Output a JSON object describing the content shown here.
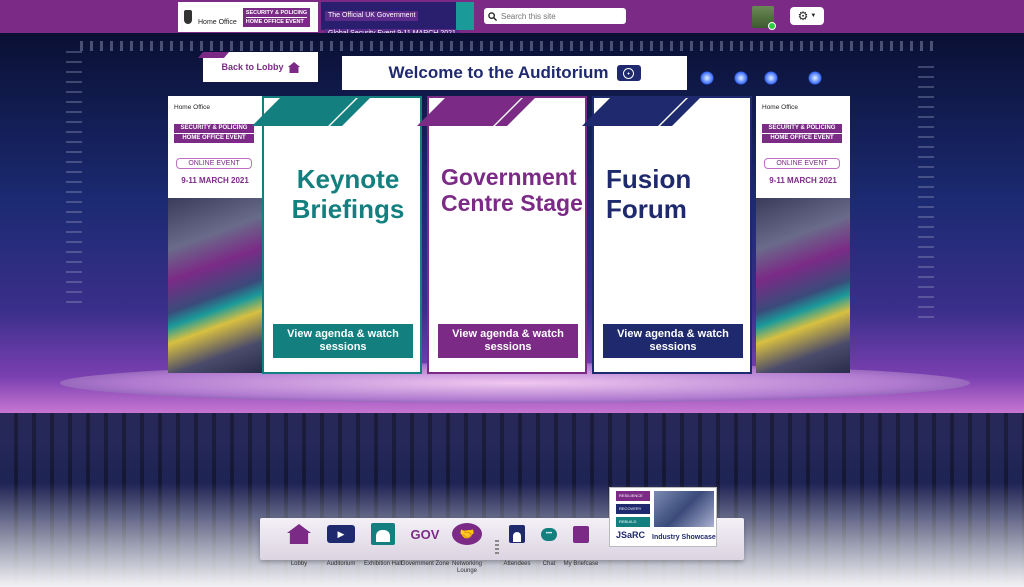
{
  "header": {
    "home_office": "Home Office",
    "security_policing": "SECURITY & POLICING",
    "home_office_event": "HOME OFFICE EVENT",
    "official_line1": "The Official UK Government",
    "official_line2": "Global Security Event  9-11 MARCH 2021",
    "search_placeholder": "Search this site",
    "settings_icon": "gear-icon"
  },
  "page": {
    "back_label": "Back to Lobby",
    "welcome_title": "Welcome to the Auditorium"
  },
  "banner": {
    "home_office": "Home Office",
    "security_policing": "SECURITY & POLICING",
    "home_office_event": "HOME OFFICE EVENT",
    "online_event": "ONLINE EVENT",
    "date": "9-11 MARCH 2021"
  },
  "panels": [
    {
      "title": "Keynote Briefings",
      "cta": "View agenda & watch sessions",
      "color": "#137f7f"
    },
    {
      "title": "Government Centre Stage",
      "cta": "View agenda & watch sessions",
      "color": "#7b2b86"
    },
    {
      "title": "Fusion Forum",
      "cta": "View agenda & watch sessions",
      "color": "#1f2a6e"
    }
  ],
  "nav": {
    "items": [
      {
        "label": "Lobby",
        "icon": "home-icon"
      },
      {
        "label": "Auditorium",
        "icon": "play-icon"
      },
      {
        "label": "Exhibition Hall",
        "icon": "exhibition-icon"
      },
      {
        "label": "Government Zone",
        "icon": "gov-icon",
        "icon_text": "GOV"
      },
      {
        "label": "Networking Lounge",
        "icon": "handshake-icon"
      },
      {
        "label": "Attendees",
        "icon": "person-icon"
      },
      {
        "label": "Chat",
        "icon": "chat-icon"
      },
      {
        "label": "My Briefcase",
        "icon": "briefcase-icon"
      }
    ]
  },
  "showcase": {
    "tags": [
      "RESILIENCE",
      "RECOVERY",
      "REBUILD"
    ],
    "logo": "JSaRC",
    "label": "Industry Showcase"
  },
  "colors": {
    "purple": "#7b2b86",
    "teal": "#137f7f",
    "navy": "#1f2a6e"
  }
}
